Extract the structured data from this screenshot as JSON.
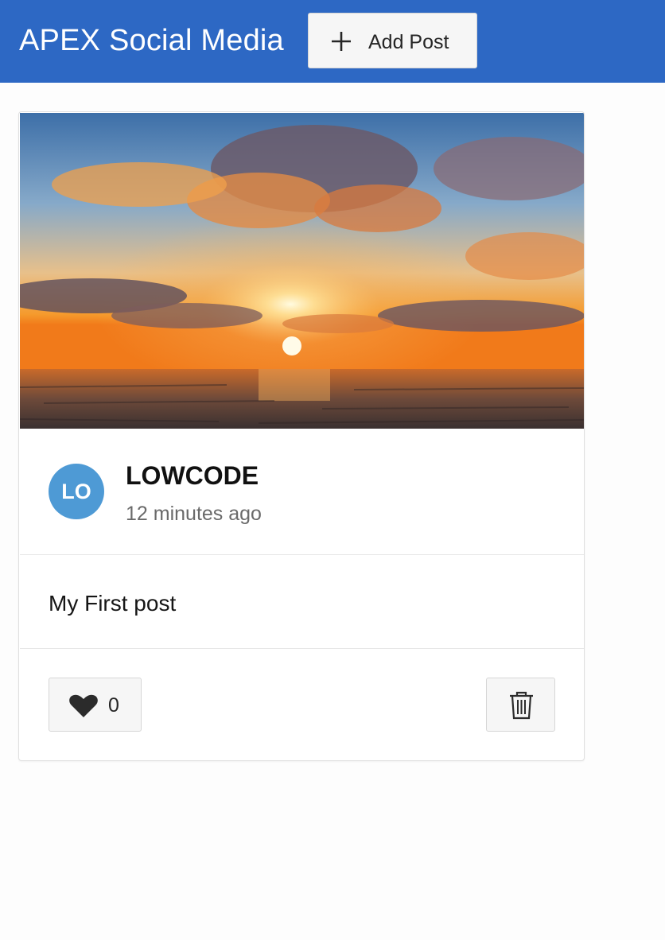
{
  "header": {
    "title": "APEX Social Media",
    "add_post_label": "Add Post",
    "background_color": "#2d68c4"
  },
  "post": {
    "image": "sunset-over-sea-photo",
    "avatar_initials": "LO",
    "avatar_color": "#4e9ad5",
    "username": "LOWCODE",
    "timestamp": "12 minutes ago",
    "text": "My First post",
    "like_count": "0",
    "like_icon": "heart-icon",
    "delete_icon": "trash-icon"
  }
}
